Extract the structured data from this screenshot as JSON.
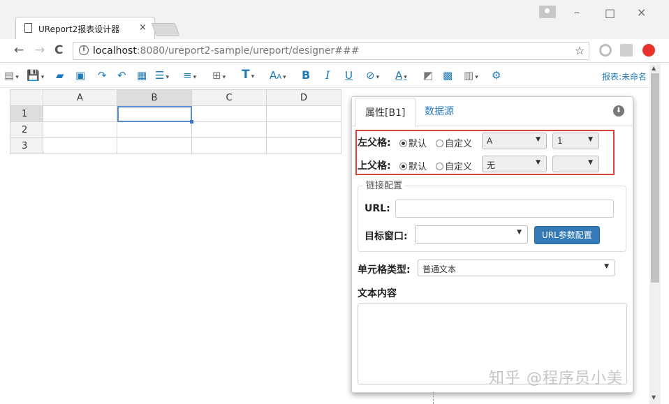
{
  "browser": {
    "tab_title": "UReport2报表设计器",
    "tab_close": "×",
    "url_host": "localhost",
    "url_rest": ":8080/ureport2-sample/ureport/designer###",
    "star": "☆",
    "window_min": "–",
    "window_max": "□",
    "window_close": "×",
    "back": "←",
    "forward": "→",
    "reload": "C",
    "info": "i"
  },
  "toolbar": {
    "report_name": "报表:未命名",
    "text_icon": "T",
    "font_size_icon": "A",
    "bold_icon": "B",
    "italic_icon": "I",
    "underline_icon": "U",
    "font_color_icon": "A",
    "dd": "▾"
  },
  "sheet": {
    "columns": [
      "A",
      "B",
      "C",
      "D"
    ],
    "rows": [
      "1",
      "2",
      "3"
    ],
    "selected_column": "B",
    "selected_row": "1"
  },
  "panel": {
    "tab_properties": "属性[B1]",
    "tab_datasource": "数据源",
    "collapse": "⬇",
    "left_parent_label": "左父格:",
    "top_parent_label": "上父格:",
    "radio_default": "默认",
    "radio_custom": "自定义",
    "left_parent_select": "A",
    "left_parent_select2": "1",
    "top_parent_select": "无",
    "top_parent_select2": "",
    "link_config_legend": "链接配置",
    "url_label": "URL:",
    "url_value": "",
    "target_window_label": "目标窗口:",
    "target_window_value": "",
    "url_params_button": "URL参数配置",
    "cell_type_label": "单元格类型:",
    "cell_type_value": "普通文本",
    "text_content_label": "文本内容",
    "text_content_value": ""
  },
  "watermark": "知乎 @程序员小美",
  "colors": {
    "accent": "#1f7ab8",
    "highlight_box": "#d9413d",
    "primary_button": "#337ab7"
  }
}
